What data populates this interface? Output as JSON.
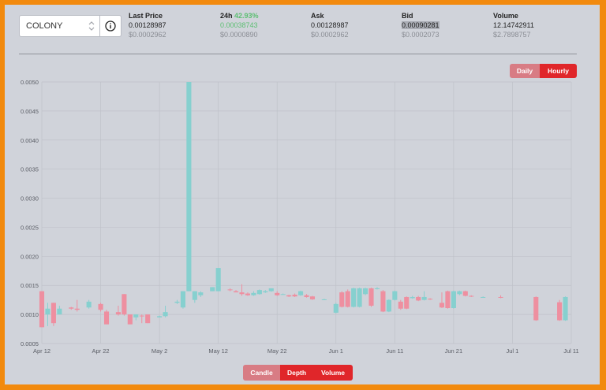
{
  "pair_selector": {
    "value": "COLONY"
  },
  "stats": {
    "last_price": {
      "label": "Last Price",
      "value": "0.00128987",
      "usd": "$0.0002962"
    },
    "change_24h": {
      "label": "24h",
      "percent": "42.93%",
      "value": "0.00038743",
      "usd": "$0.0000890"
    },
    "ask": {
      "label": "Ask",
      "value": "0.00128987",
      "usd": "$0.0002962"
    },
    "bid": {
      "label": "Bid",
      "value": "0.00090281",
      "usd": "$0.0002073"
    },
    "volume": {
      "label": "Volume",
      "value": "12.14742911",
      "usd": "$2.7898757"
    }
  },
  "interval_toggle": {
    "daily": "Daily",
    "hourly": "Hourly",
    "selected": "Hourly"
  },
  "view_buttons": {
    "candle": "Candle",
    "depth": "Depth",
    "volume": "Volume",
    "selected": "Candle"
  },
  "colors": {
    "up": "#86d0cf",
    "down": "#ee8fa0",
    "accent": "#e0262a",
    "accent_muted": "#d87c84",
    "background": "#d0d3da",
    "border": "#f28a0e"
  },
  "chart_data": {
    "type": "candlestick",
    "grid": true,
    "ylim": [
      0.0005,
      0.005
    ],
    "yticks": [
      "0.0005",
      "0.0010",
      "0.0015",
      "0.0020",
      "0.0025",
      "0.0030",
      "0.0035",
      "0.0040",
      "0.0045",
      "0.0050"
    ],
    "xticks": [
      "Apr 12",
      "Apr 22",
      "May 2",
      "May 12",
      "May 22",
      "Jun 1",
      "Jun 11",
      "Jun 21",
      "Jul 1",
      "Jul 11"
    ],
    "x_start": "Apr 12",
    "x_end": "Jul 11",
    "candles": [
      {
        "date": "Apr 12",
        "open": 0.0014,
        "close": 0.00078,
        "high": 0.0014,
        "low": 0.00078
      },
      {
        "date": "Apr 13",
        "open": 0.001,
        "close": 0.0011,
        "high": 0.0012,
        "low": 0.0008
      },
      {
        "date": "Apr 14",
        "open": 0.0012,
        "close": 0.00085,
        "high": 0.0012,
        "low": 0.0008
      },
      {
        "date": "Apr 15",
        "open": 0.001,
        "close": 0.0011,
        "high": 0.00115,
        "low": 0.001
      },
      {
        "date": "Apr 17",
        "open": 0.00112,
        "close": 0.0011,
        "high": 0.00113,
        "low": 0.00108
      },
      {
        "date": "Apr 18",
        "open": 0.0011,
        "close": 0.00108,
        "high": 0.00125,
        "low": 0.00105
      },
      {
        "date": "Apr 20",
        "open": 0.00112,
        "close": 0.00122,
        "high": 0.00125,
        "low": 0.0011
      },
      {
        "date": "Apr 22",
        "open": 0.00118,
        "close": 0.00108,
        "high": 0.0012,
        "low": 0.00105
      },
      {
        "date": "Apr 23",
        "open": 0.00105,
        "close": 0.00083,
        "high": 0.00108,
        "low": 0.00083
      },
      {
        "date": "Apr 25",
        "open": 0.00104,
        "close": 0.001,
        "high": 0.00115,
        "low": 0.00098
      },
      {
        "date": "Apr 26",
        "open": 0.00135,
        "close": 0.001,
        "high": 0.00135,
        "low": 0.00098
      },
      {
        "date": "Apr 27",
        "open": 0.001,
        "close": 0.00083,
        "high": 0.001,
        "low": 0.00083
      },
      {
        "date": "Apr 28",
        "open": 0.00095,
        "close": 0.001,
        "high": 0.001,
        "low": 0.0009
      },
      {
        "date": "Apr 29",
        "open": 0.00098,
        "close": 0.00097,
        "high": 0.001,
        "low": 0.00085
      },
      {
        "date": "Apr 30",
        "open": 0.001,
        "close": 0.00085,
        "high": 0.001,
        "low": 0.00085
      },
      {
        "date": "May 2",
        "open": 0.00095,
        "close": 0.00097,
        "high": 0.00098,
        "low": 0.00095
      },
      {
        "date": "May 3",
        "open": 0.00097,
        "close": 0.00104,
        "high": 0.00115,
        "low": 0.00095
      },
      {
        "date": "May 5",
        "open": 0.0012,
        "close": 0.00122,
        "high": 0.00125,
        "low": 0.00118
      },
      {
        "date": "May 6",
        "open": 0.00112,
        "close": 0.0014,
        "high": 0.0014,
        "low": 0.0011
      },
      {
        "date": "May 7",
        "open": 0.0014,
        "close": 0.005,
        "high": 0.005,
        "low": 0.0014
      },
      {
        "date": "May 8",
        "open": 0.00125,
        "close": 0.0014,
        "high": 0.0014,
        "low": 0.0012
      },
      {
        "date": "May 9",
        "open": 0.00133,
        "close": 0.00138,
        "high": 0.0014,
        "low": 0.0013
      },
      {
        "date": "May 11",
        "open": 0.0014,
        "close": 0.00147,
        "high": 0.00147,
        "low": 0.0014
      },
      {
        "date": "May 12",
        "open": 0.0014,
        "close": 0.0018,
        "high": 0.0018,
        "low": 0.0014
      },
      {
        "date": "May 14",
        "open": 0.00143,
        "close": 0.00142,
        "high": 0.00145,
        "low": 0.0014
      },
      {
        "date": "May 15",
        "open": 0.0014,
        "close": 0.00138,
        "high": 0.00142,
        "low": 0.00138
      },
      {
        "date": "May 16",
        "open": 0.00138,
        "close": 0.00135,
        "high": 0.00152,
        "low": 0.00132
      },
      {
        "date": "May 17",
        "open": 0.00136,
        "close": 0.00133,
        "high": 0.00138,
        "low": 0.00132
      },
      {
        "date": "May 18",
        "open": 0.00133,
        "close": 0.00137,
        "high": 0.0014,
        "low": 0.00132
      },
      {
        "date": "May 19",
        "open": 0.00135,
        "close": 0.00142,
        "high": 0.00143,
        "low": 0.00134
      },
      {
        "date": "May 20",
        "open": 0.00138,
        "close": 0.0014,
        "high": 0.00142,
        "low": 0.00137
      },
      {
        "date": "May 21",
        "open": 0.0014,
        "close": 0.00145,
        "high": 0.00145,
        "low": 0.00139
      },
      {
        "date": "May 22",
        "open": 0.00137,
        "close": 0.00133,
        "high": 0.0014,
        "low": 0.00132
      },
      {
        "date": "May 23",
        "open": 0.00135,
        "close": 0.00135,
        "high": 0.00136,
        "low": 0.00134
      },
      {
        "date": "May 24",
        "open": 0.00133,
        "close": 0.00131,
        "high": 0.00134,
        "low": 0.0013
      },
      {
        "date": "May 25",
        "open": 0.00134,
        "close": 0.00131,
        "high": 0.00136,
        "low": 0.0013
      },
      {
        "date": "May 26",
        "open": 0.00133,
        "close": 0.0014,
        "high": 0.00141,
        "low": 0.00132
      },
      {
        "date": "May 27",
        "open": 0.00133,
        "close": 0.0013,
        "high": 0.00135,
        "low": 0.00129
      },
      {
        "date": "May 28",
        "open": 0.00131,
        "close": 0.00126,
        "high": 0.00132,
        "low": 0.00125
      },
      {
        "date": "May 30",
        "open": 0.00126,
        "close": 0.00126,
        "high": 0.00127,
        "low": 0.00125
      },
      {
        "date": "Jun 1",
        "open": 0.00103,
        "close": 0.00118,
        "high": 0.0012,
        "low": 0.00102
      },
      {
        "date": "Jun 2",
        "open": 0.00138,
        "close": 0.00113,
        "high": 0.0014,
        "low": 0.00112
      },
      {
        "date": "Jun 3",
        "open": 0.0014,
        "close": 0.00113,
        "high": 0.00143,
        "low": 0.00112
      },
      {
        "date": "Jun 4",
        "open": 0.00113,
        "close": 0.00145,
        "high": 0.00146,
        "low": 0.00112
      },
      {
        "date": "Jun 5",
        "open": 0.00113,
        "close": 0.00145,
        "high": 0.00146,
        "low": 0.00112
      },
      {
        "date": "Jun 6",
        "open": 0.00135,
        "close": 0.00145,
        "high": 0.00146,
        "low": 0.00133
      },
      {
        "date": "Jun 7",
        "open": 0.00145,
        "close": 0.00115,
        "high": 0.00146,
        "low": 0.00113
      },
      {
        "date": "Jun 8",
        "open": 0.00145,
        "close": 0.00145,
        "high": 0.00147,
        "low": 0.00143
      },
      {
        "date": "Jun 9",
        "open": 0.0014,
        "close": 0.00105,
        "high": 0.00142,
        "low": 0.00104
      },
      {
        "date": "Jun 10",
        "open": 0.00105,
        "close": 0.00125,
        "high": 0.00126,
        "low": 0.00104
      },
      {
        "date": "Jun 11",
        "open": 0.00125,
        "close": 0.0014,
        "high": 0.00141,
        "low": 0.00124
      },
      {
        "date": "Jun 12",
        "open": 0.00122,
        "close": 0.0011,
        "high": 0.00125,
        "low": 0.00108
      },
      {
        "date": "Jun 13",
        "open": 0.0013,
        "close": 0.0011,
        "high": 0.00131,
        "low": 0.00109
      },
      {
        "date": "Jun 14",
        "open": 0.00128,
        "close": 0.0013,
        "high": 0.00132,
        "low": 0.00127
      },
      {
        "date": "Jun 15",
        "open": 0.0013,
        "close": 0.00124,
        "high": 0.00132,
        "low": 0.00123
      },
      {
        "date": "Jun 16",
        "open": 0.00125,
        "close": 0.0013,
        "high": 0.0014,
        "low": 0.00124
      },
      {
        "date": "Jun 17",
        "open": 0.00127,
        "close": 0.00126,
        "high": 0.00128,
        "low": 0.00125
      },
      {
        "date": "Jun 19",
        "open": 0.0012,
        "close": 0.00112,
        "high": 0.00138,
        "low": 0.00111
      },
      {
        "date": "Jun 20",
        "open": 0.0014,
        "close": 0.00111,
        "high": 0.00141,
        "low": 0.0011
      },
      {
        "date": "Jun 21",
        "open": 0.00111,
        "close": 0.0014,
        "high": 0.00141,
        "low": 0.0011
      },
      {
        "date": "Jun 22",
        "open": 0.00135,
        "close": 0.0014,
        "high": 0.00141,
        "low": 0.00133
      },
      {
        "date": "Jun 23",
        "open": 0.0014,
        "close": 0.00132,
        "high": 0.00141,
        "low": 0.00131
      },
      {
        "date": "Jun 24",
        "open": 0.00132,
        "close": 0.00131,
        "high": 0.00133,
        "low": 0.0013
      },
      {
        "date": "Jun 26",
        "open": 0.0013,
        "close": 0.0013,
        "high": 0.00131,
        "low": 0.00129
      },
      {
        "date": "Jun 29",
        "open": 0.0013,
        "close": 0.00129,
        "high": 0.00133,
        "low": 0.00128
      },
      {
        "date": "Jul 5",
        "open": 0.0013,
        "close": 0.0009,
        "high": 0.00131,
        "low": 0.00089
      },
      {
        "date": "Jul 9",
        "open": 0.00121,
        "close": 0.0009,
        "high": 0.00125,
        "low": 0.00089
      },
      {
        "date": "Jul 10",
        "open": 0.0009,
        "close": 0.0013,
        "high": 0.00131,
        "low": 0.00089
      }
    ]
  }
}
